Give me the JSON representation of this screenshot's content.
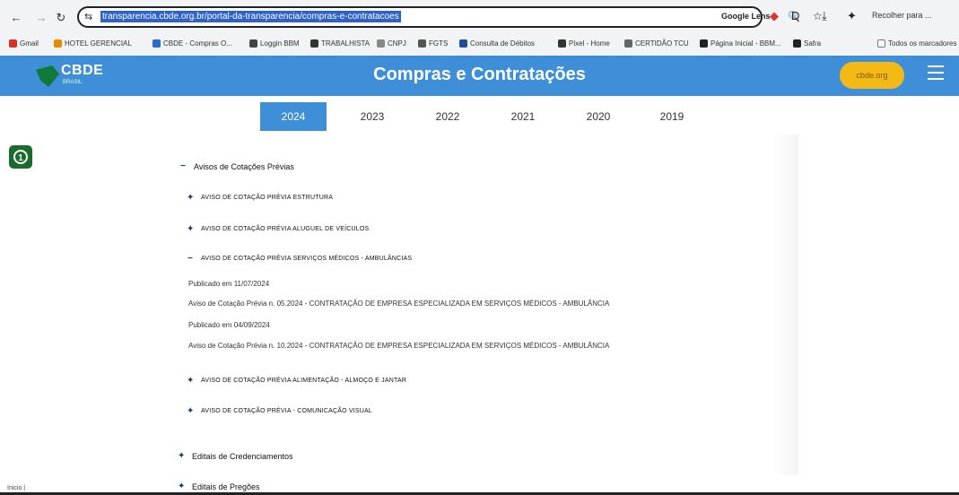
{
  "browser": {
    "back_icon": "←",
    "forward_icon": "→",
    "reload_icon": "↻",
    "site_info_icon": "⇆",
    "url": "transparencia.cbde.org.br/portal-da-transparencia/compras-e-contratacoes",
    "lens_label": "Google Lens",
    "zoom_icon": "🔍",
    "star_icon": "☆",
    "profile_label": "Recolher para ...",
    "bookmarks": [
      {
        "label": "Gmail",
        "color": "#d93025"
      },
      {
        "label": "HOTEL GERENCIAL",
        "color": "#e68a00"
      },
      {
        "label": "CBDE - Compras O...",
        "color": "#2a6bd1"
      },
      {
        "label": "Loggin BBM",
        "color": "#444444"
      },
      {
        "label": "TRABALHISTA",
        "color": "#333333"
      },
      {
        "label": "CNPJ",
        "color": "#888888"
      },
      {
        "label": "FGTS",
        "color": "#555555"
      },
      {
        "label": "Consulta de Débitos",
        "color": "#1f4e9b"
      },
      {
        "label": "Pixel - Home",
        "color": "#333333"
      },
      {
        "label": "CERTIDÃO TCU",
        "color": "#666666"
      },
      {
        "label": "Página Inicial - BBM...",
        "color": "#222222"
      },
      {
        "label": "Safra",
        "color": "#222222"
      },
      {
        "label": "Todos os marcadores",
        "color": "#999999"
      }
    ]
  },
  "header": {
    "logo_text": "CBDE",
    "logo_sub": "BRASIL",
    "title": "Compras e Contratações",
    "cta_label": "cbde.org",
    "brand_color": "#3f8fd8",
    "accent_color": "#f5b915"
  },
  "years": [
    "2024",
    "2023",
    "2022",
    "2021",
    "2020",
    "2019"
  ],
  "active_year": "2024",
  "side_badge": "1",
  "sections": {
    "avisos": {
      "title": "Avisos de Cotações Prévias",
      "items": [
        "AVISO DE COTAÇÃO PRÉVIA ESTRUTURA",
        "AVISO DE COTAÇÃO PRÉVIA ALUGUEL DE VEÍCULOS",
        "AVISO DE COTAÇÃO PRÉVIA SERVIÇOS MÉDICOS - AMBULÂNCIAS",
        "AVISO DE COTAÇÃO PRÉVIA ALIMENTAÇÃO - ALMOÇO E JANTAR",
        "AVISO DE COTAÇÃO PRÉVIA - COMUNICAÇÃO VISUAL"
      ],
      "expanded_details": [
        "Publicado em 11/07/2024",
        "Aviso de Cotação Prévia n. 05.2024 - CONTRATAÇÃO DE EMPRESA ESPECIALIZADA EM SERVIÇOS MÉDICOS - AMBULÂNCIA",
        "Publicado em 04/09/2024",
        "Aviso de Cotação Prévia n. 10.2024 - CONTRATAÇÃO DE EMPRESA ESPECIALIZADA EM SERVIÇOS MÉDICOS - AMBULÂNCIA"
      ]
    },
    "editais_credenciamento": {
      "title": "Editais de Credenciamentos"
    },
    "editais_pregoes": {
      "title": "Editais de Pregões"
    }
  },
  "status_text": "Inicio |"
}
